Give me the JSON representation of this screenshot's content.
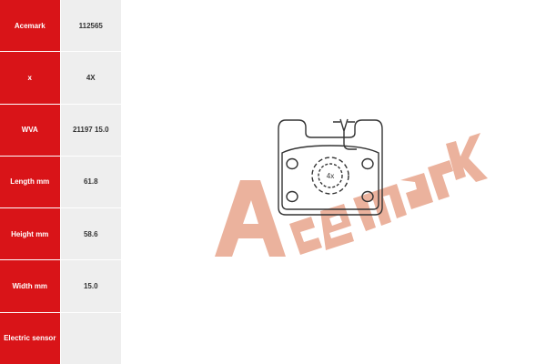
{
  "specs": [
    {
      "label": "Acemark",
      "value": "112565"
    },
    {
      "label": "x",
      "value": "4X"
    },
    {
      "label": "WVA",
      "value": "21197 15.0"
    },
    {
      "label": "Length mm",
      "value": "61.8"
    },
    {
      "label": "Height mm",
      "value": "58.6"
    },
    {
      "label": "Width mm",
      "value": "15.0"
    },
    {
      "label": "Electric sensor",
      "value": ""
    }
  ],
  "drawing": {
    "quantity_label": "4x",
    "watermark_text": "Acemark"
  },
  "colors": {
    "label_bg": "#d91418",
    "value_bg": "#eeeeee",
    "watermark": "#e8a58c",
    "outline": "#333333"
  }
}
